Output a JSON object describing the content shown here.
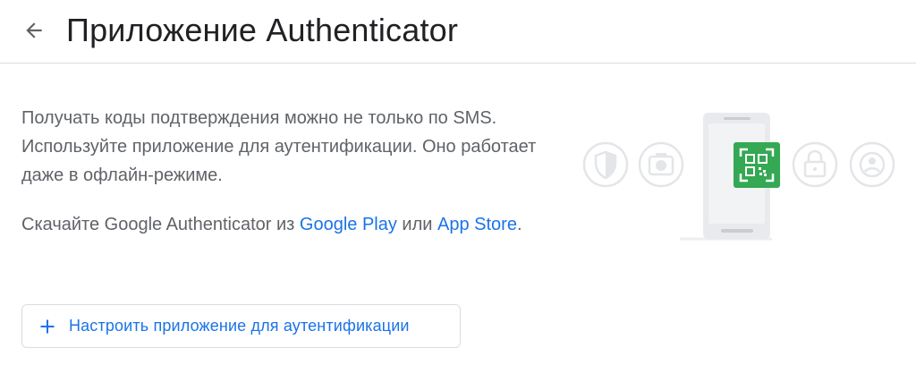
{
  "header": {
    "back_icon": "arrow-back-icon",
    "title": "Приложение Authenticator"
  },
  "main": {
    "description": "Получать коды подтверждения можно не только по SMS. Используйте приложение для аутентификации. Оно работает даже в офлайн-режиме.",
    "download_prefix": "Скачайте Google Authenticator из ",
    "google_play_link": "Google Play",
    "download_middle": " или ",
    "app_store_link": "App Store",
    "download_suffix": ".",
    "setup_button": {
      "icon": "plus-icon",
      "label": "Настроить приложение для аутентификации"
    }
  },
  "illustration": {
    "icons": [
      "shield-icon",
      "camera-icon",
      "qr-code-icon",
      "lock-icon",
      "account-icon"
    ],
    "accent_color": "#34a853"
  },
  "colors": {
    "link": "#1a73e8",
    "text_secondary": "#5f6368",
    "title": "#202124",
    "divider": "#dadce0"
  }
}
